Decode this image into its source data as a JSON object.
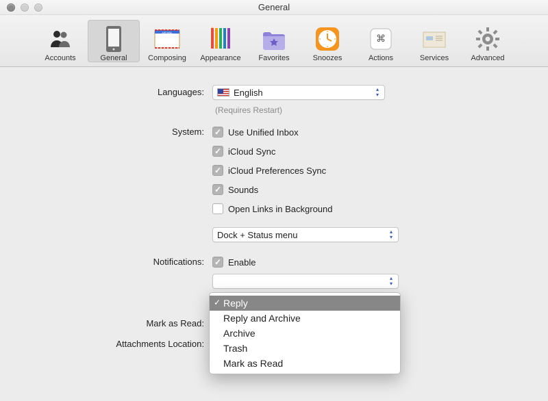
{
  "window": {
    "title": "General"
  },
  "tabs": [
    {
      "id": "accounts",
      "label": "Accounts"
    },
    {
      "id": "general",
      "label": "General"
    },
    {
      "id": "composing",
      "label": "Composing"
    },
    {
      "id": "appearance",
      "label": "Appearance"
    },
    {
      "id": "favorites",
      "label": "Favorites"
    },
    {
      "id": "snoozes",
      "label": "Snoozes"
    },
    {
      "id": "actions",
      "label": "Actions"
    },
    {
      "id": "services",
      "label": "Services"
    },
    {
      "id": "advanced",
      "label": "Advanced"
    }
  ],
  "selected_tab": "general",
  "form": {
    "languages": {
      "label": "Languages:",
      "value": "English",
      "hint": "(Requires Restart)"
    },
    "system": {
      "label": "System:",
      "checks": [
        {
          "id": "unified",
          "label": "Use Unified Inbox",
          "checked": true
        },
        {
          "id": "icloud",
          "label": "iCloud Sync",
          "checked": true
        },
        {
          "id": "prefsync",
          "label": "iCloud Preferences Sync",
          "checked": true
        },
        {
          "id": "sounds",
          "label": "Sounds",
          "checked": true
        },
        {
          "id": "bglinks",
          "label": "Open Links in Background",
          "checked": false
        }
      ],
      "menu_mode": "Dock + Status menu"
    },
    "notifications": {
      "label": "Notifications:",
      "enable_label": "Enable",
      "enable_checked": true,
      "action_select": {
        "options": [
          "Reply",
          "Reply and Archive",
          "Archive",
          "Trash",
          "Mark as Read"
        ],
        "selected": "Reply"
      }
    },
    "mark_as_read": {
      "label": "Mark as Read:"
    },
    "attachments": {
      "label": "Attachments Location:"
    }
  }
}
